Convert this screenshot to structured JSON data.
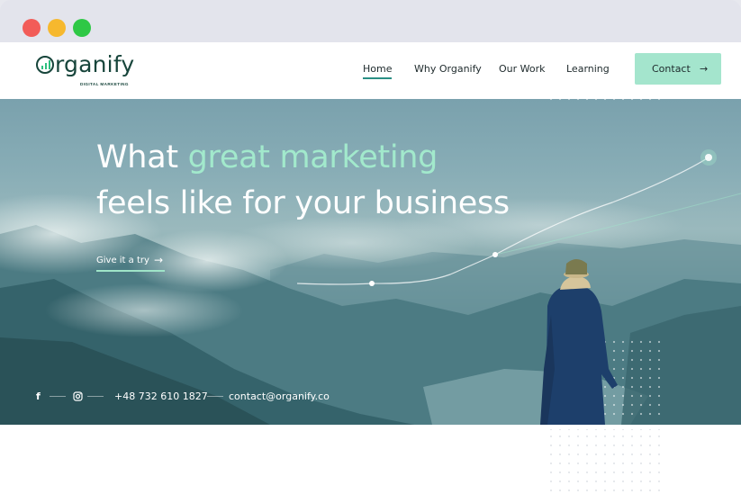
{
  "window": {
    "controls": [
      "close",
      "minimize",
      "maximize"
    ],
    "colors": {
      "close": "#f25c58",
      "minimize": "#f6b82e",
      "maximize": "#2ec845"
    }
  },
  "header": {
    "logo": {
      "name": "rganify",
      "tagline": "DIGITAL MARKETING"
    },
    "nav": [
      {
        "label": "Home",
        "active": true
      },
      {
        "label": "Why Organify",
        "active": false
      },
      {
        "label": "Our Work",
        "active": false
      },
      {
        "label": "Learning",
        "active": false
      }
    ],
    "contact_button": {
      "label": "Contact",
      "icon": "arrow-right-icon",
      "color": "#a4e5cd"
    }
  },
  "hero": {
    "headline": {
      "line1_prefix": "What ",
      "line1_accent": "great marketing",
      "line2": "feels like for your business"
    },
    "accent_color": "#a2e9cc",
    "cta": {
      "label": "Give it a try",
      "icon": "arrow-right-icon"
    },
    "social_icons": [
      "facebook-icon",
      "instagram-icon"
    ],
    "phone": "+48 732 610 1827",
    "email": "contact@organify.co"
  }
}
